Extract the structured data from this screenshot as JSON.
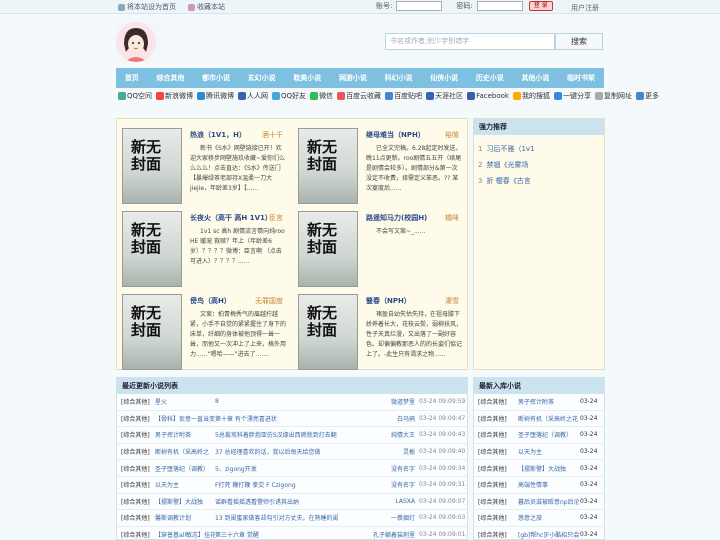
{
  "topbar": {
    "home_label": "将本站设为首页",
    "fav_label": "收藏本站",
    "account_label": "账号:",
    "password_label": "密码:",
    "login_label": "登 录",
    "register_label": "用户注册"
  },
  "search": {
    "placeholder": "书名或作者,别少字别错字",
    "button": "搜索"
  },
  "nav": [
    "首页",
    "综合其他",
    "都市小说",
    "玄幻小说",
    "耽美小说",
    "网游小说",
    "科幻小说",
    "仙侠小说",
    "历史小说",
    "其他小说",
    "临时书架"
  ],
  "share": [
    "QQ空间",
    "新浪微博",
    "腾讯微博",
    "人人网",
    "QQ好友",
    "微信",
    "百度云收藏",
    "百度贴吧",
    "天涯社区",
    "Facebook",
    "我的搜狐",
    "一键分享",
    "复制网址",
    "更多"
  ],
  "cover_text": [
    "新",
    "无",
    "封",
    "面"
  ],
  "books": [
    {
      "title": "热浪（1V1，H）",
      "author": "酒十千",
      "desc": "新书《S水》网壁链接已开！欢迎大家移步网壁施玖收藏~爱你们么么么么！点击直达：《S水》传送门【暴爆绿茶老部持X温柔一刀大jiejie，年龄差3岁】【......"
    },
    {
      "title": "继母难当（NPH）",
      "author": "裕暄",
      "desc": "已全文完稿。6.28起定时发送，晚11点更新。roo剧情五五开（续尾是剧情会较多）。剧情部分&第一次没定不收费，择需定义笨恶。?? 某次宴度后......"
    },
    {
      "title": "长夜火（高干 高H 1V1）",
      "author": "臣言",
      "desc": "1v1 sc 高h 剧情流言情向纯roo HE 暖宠 救赎？年上（年龄差6岁）？？？？微博：臣言啊 （点击可进入）？？？？......"
    },
    {
      "title": "路遥知马力(校园H)",
      "author": "橘咪",
      "desc": "不会写文案~_......"
    },
    {
      "title": "傍鸟（高H）",
      "author": "无罪国度",
      "desc": "文案：拍青梅秀气的眉越拧越紧，小手不自觉的紧紧握住了身下的床单，纤细的身体被他顶得一耸一耸，而他又一次冲上了上来，格外用力......“嗯哈——”进去了......."
    },
    {
      "title": "豎春（NPH）",
      "author": "灌雪",
      "desc": "褚盈自幼失怙失持，在祖母膝下娇养着长大，花枝云鬓，弱柳扶风，性子天真烂漫，又出落了一副好容色。却偏偏教那恶人的的长姿们惦记上了。-此生只有渴求之物......"
    }
  ],
  "right_panel": {
    "title": "强力推荐",
    "items": [
      "习后不雅（1v1",
      "禁锢《光雾场",
      "折 樱春《古言"
    ]
  },
  "latest_list": {
    "title": "最近更新小说列表",
    "rows": [
      {
        "cat": "[综合其他]",
        "title": "星火",
        "chapter": "8",
        "author": "微道梦里",
        "time": "03-24 09:09:59"
      },
      {
        "cat": "[综合其他]",
        "title": "【骨科】妄意一直当变",
        "chapter": "第十章 有个漂亮喜进状",
        "author": "白马鸦",
        "time": "03-24 09:09:47"
      },
      {
        "cat": "[综合其他]",
        "title": "男子挥计附茶",
        "chapter": "5总裁攻科着胖炮亚仿S汉缘出西裤就到灯去翻",
        "author": "纯情大王",
        "time": "03-24 09:09:43"
      },
      {
        "cat": "[综合其他]",
        "title": "断树有机（采高岭之",
        "chapter": "37 总经理喜欢的话，我以后每天给您做",
        "author": "灵栀",
        "time": "03-24 09:09:40"
      },
      {
        "cat": "[综合其他]",
        "title": "圣子堕落纪（调教）",
        "chapter": "5、zigong开发",
        "author": "没有名字",
        "time": "03-24 09:09:34"
      },
      {
        "cat": "[综合其他]",
        "title": "以天为主",
        "chapter": "F打死 鞭打鞭 拳交 F Czigong",
        "author": "没有名字",
        "time": "03-24 09:09:31"
      },
      {
        "cat": "[综合其他]",
        "title": "【摆斯警】大战独",
        "chapter": "谣群看摇摇透看警师引诱其出纳",
        "author": "LASXA",
        "time": "03-24 09:09:07"
      },
      {
        "cat": "[综合其他]",
        "title": "馨斯调教计划",
        "chapter": "13 到闺蜜家做客却勾引对方丈夫。在熟睡的闺",
        "author": "一蓑烟灯",
        "time": "03-24 09:09:03"
      },
      {
        "cat": "[综合其他]",
        "title": "【穿普基all敏志】挂花",
        "chapter": "第三十六章 觉醒",
        "author": "孔子躺着装刺里",
        "time": "03-24 09:09:01"
      }
    ]
  },
  "new_list": {
    "title": "最新入库小说",
    "rows": [
      {
        "cat": "[综合其他]",
        "title": "男子挥计附茶",
        "date": "03-24"
      },
      {
        "cat": "[综合其他]",
        "title": "断树有机（采高岭之花",
        "date": "03-24"
      },
      {
        "cat": "[综合其他]",
        "title": "圣子堕落纪（调教）",
        "date": "03-24"
      },
      {
        "cat": "[综合其他]",
        "title": "以天为主",
        "date": "03-24"
      },
      {
        "cat": "[综合其他]",
        "title": "【摆斯警】大战独",
        "date": "03-24"
      },
      {
        "cat": "[综合其他]",
        "title": "高端性情事",
        "date": "03-24"
      },
      {
        "cat": "[综合其他]",
        "title": "暮后员滋被殴意np后沦为共妻",
        "date": "03-24"
      },
      {
        "cat": "[综合其他]",
        "title": "悠意之旅",
        "date": "03-24"
      },
      {
        "cat": "[综合其他]",
        "title": "[gb]帮hc]F小酷招只会安置你",
        "date": "03-24"
      }
    ]
  }
}
